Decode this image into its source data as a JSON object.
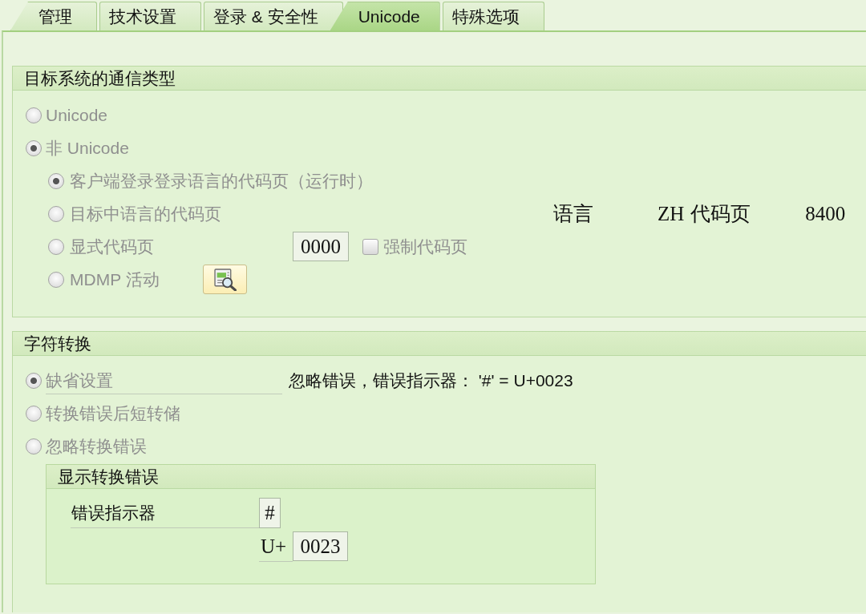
{
  "tabs": [
    {
      "label": "管理",
      "selected": false
    },
    {
      "label": "技术设置",
      "selected": false
    },
    {
      "label": "登录 & 安全性",
      "selected": false
    },
    {
      "label": "Unicode",
      "selected": true
    },
    {
      "label": "特殊选项",
      "selected": false
    }
  ],
  "communication_type": {
    "title": "目标系统的通信类型",
    "options": [
      {
        "label": "Unicode",
        "selected": false,
        "disabled": true
      },
      {
        "label": "非 Unicode",
        "selected": true,
        "disabled": true,
        "children": [
          {
            "kind": "plain",
            "label": "客户端登录登录语言的代码页（运行时）",
            "selected": true,
            "disabled": true
          },
          {
            "kind": "info",
            "label": "目标中语言的代码页",
            "selected": false,
            "disabled": true,
            "language": {
              "label": "语言",
              "value": "ZH"
            },
            "code_page": {
              "label": "代码页",
              "value": "8400"
            }
          },
          {
            "kind": "field",
            "label": "显式代码页",
            "selected": false,
            "disabled": true,
            "field": {
              "value": "0000"
            },
            "checkbox": {
              "label": "强制代码页",
              "checked": false,
              "disabled": true
            }
          },
          {
            "kind": "button",
            "label": "MDMP 活动",
            "selected": false,
            "disabled": true
          }
        ]
      }
    ]
  },
  "character_conversion": {
    "title": "字符转换",
    "options": [
      {
        "kind": "note",
        "label": "缺省设置",
        "selected": true,
        "disabled": true,
        "note": "忽略错误，错误指示器： '#' = U+0023"
      },
      {
        "kind": "plain",
        "label": "转换错误后短转储",
        "selected": false,
        "disabled": true
      },
      {
        "kind": "plain",
        "label": "忽略转换错误",
        "selected": false,
        "disabled": true
      }
    ],
    "display_errors": {
      "title": "显示转换错误",
      "fields": [
        {
          "label": "错误指示器",
          "value": "#"
        },
        {
          "prefix": "U+",
          "value": "0023"
        }
      ]
    }
  }
}
